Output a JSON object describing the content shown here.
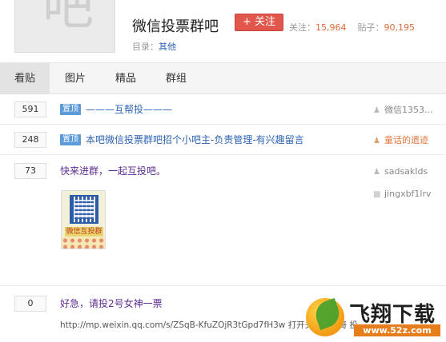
{
  "forum": {
    "avatar_glyph": "吧",
    "title": "微信投票群吧",
    "follow_label": "+ 关注",
    "followers_label": "关注：",
    "followers_count": "15,964",
    "posts_label": "贴子：",
    "posts_count": "90,195",
    "dir_label": "目录：",
    "dir_value": "其他"
  },
  "tabs": [
    {
      "label": "看贴",
      "active": true
    },
    {
      "label": "图片",
      "active": false
    },
    {
      "label": "精品",
      "active": false
    },
    {
      "label": "群组",
      "active": false
    }
  ],
  "threads": [
    {
      "replies": "591",
      "pinned_label": "置顶",
      "title": "———互帮投———",
      "author": "微信1353...",
      "author_highlight": false
    },
    {
      "replies": "248",
      "pinned_label": "置顶",
      "title": "本吧微信投票群吧招个小吧主-负责管理-有兴趣留言",
      "author": "童话的遗迹",
      "author_highlight": true
    },
    {
      "replies": "73",
      "title": "快来进群，一起互投吧。",
      "author": "sadsakIds",
      "last_reply": "jingxbf1lrv",
      "image_caption": "微信互投群"
    },
    {
      "replies": "0",
      "title": "好急，请投2号女神一票",
      "excerpt": "http://mp.weixin.qq.com/s/ZSqB-KfuZOjR3tGpd7fH3w 打开关注羚羊哥 投"
    }
  ],
  "watermark": {
    "brand": "飞翔下载",
    "url": "www.52z.com"
  },
  "colors": {
    "accent": "#e2574c",
    "link": "#2d64b3",
    "pin": "#5b9bd8",
    "count": "#e06a3a"
  },
  "icons": {
    "author": "user-icon",
    "last_reply": "comment-icon"
  }
}
